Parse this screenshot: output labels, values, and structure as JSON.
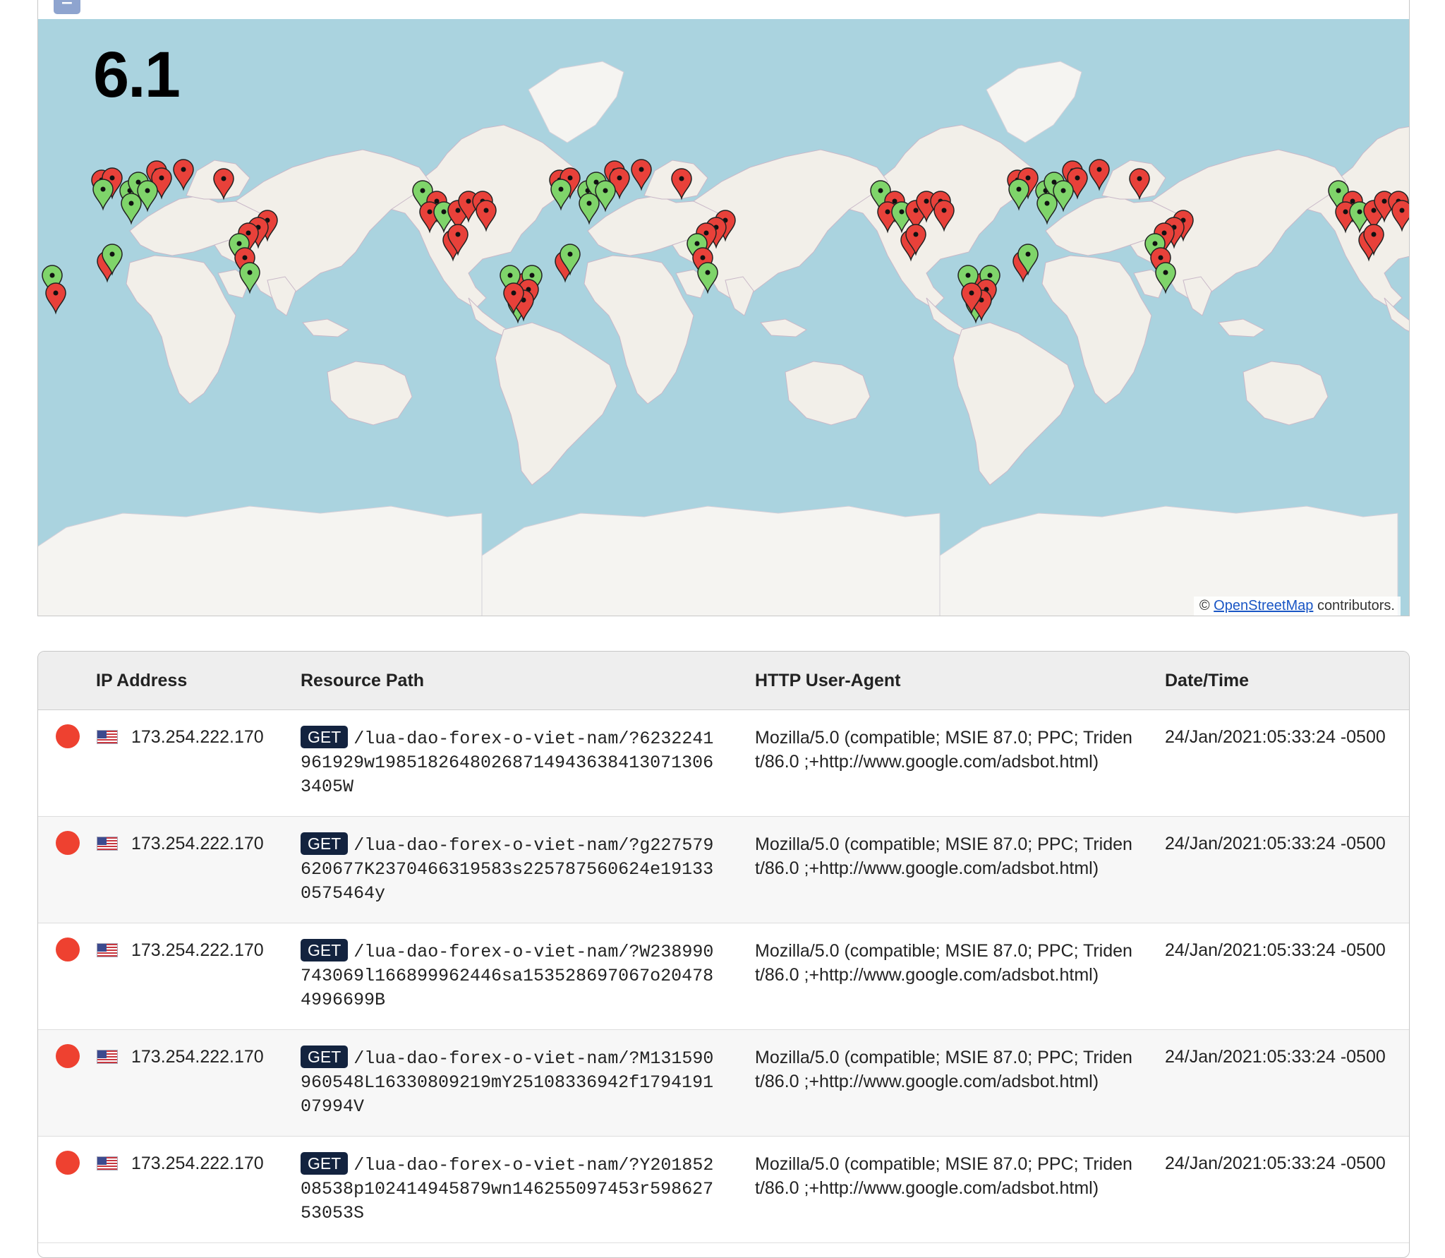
{
  "map": {
    "zoom_out_label": "−",
    "score": "6.1",
    "attribution_prefix": "©",
    "attribution_link": "OpenStreetMap",
    "attribution_suffix": "contributors.",
    "colors": {
      "ocean": "#aad3df",
      "land": "#f2efe9",
      "ice": "#f5f4f1",
      "marker_red": "#e8413a",
      "marker_green": "#7fd46a"
    }
  },
  "table": {
    "headers": {
      "ip": "IP Address",
      "path": "Resource Path",
      "ua": "HTTP User-Agent",
      "date": "Date/Time"
    },
    "rows": [
      {
        "status_color": "#ee4130",
        "ip": "173.254.222.170",
        "method": "GET",
        "path": "/lua-dao-forex-o-viet-nam/?6232241961929w19851826480268714943638413071306340​5W",
        "ua": "Mozilla/5.0 (compatible; MSIE 87.0; PPC; Trident/86.0 ;+http://www.google.com/adsbot.html)",
        "datetime": "24/Jan/2021:05:33:24 -0500"
      },
      {
        "status_color": "#ee4130",
        "ip": "173.254.222.170",
        "method": "GET",
        "path": "/lua-dao-forex-o-viet-nam/?g227579620677K2370466319583s225787560624e191330575464y",
        "ua": "Mozilla/5.0 (compatible; MSIE 87.0; PPC; Trident/86.0 ;+http://www.google.com/adsbot.html)",
        "datetime": "24/Jan/2021:05:33:24 -0500"
      },
      {
        "status_color": "#ee4130",
        "ip": "173.254.222.170",
        "method": "GET",
        "path": "/lua-dao-forex-o-viet-nam/?W238990743069l166899962446sa153528697067o204784996699B",
        "ua": "Mozilla/5.0 (compatible; MSIE 87.0; PPC; Trident/86.0 ;+http://www.google.com/adsbot.html)",
        "datetime": "24/Jan/2021:05:33:24 -0500"
      },
      {
        "status_color": "#ee4130",
        "ip": "173.254.222.170",
        "method": "GET",
        "path": "/lua-dao-forex-o-viet-nam/?M131590960548L16330809219mY25108336942f179419107994V",
        "ua": "Mozilla/5.0 (compatible; MSIE 87.0; PPC; Trident/86.0 ;+http://www.google.com/adsbot.html)",
        "datetime": "24/Jan/2021:05:33:24 -0500"
      },
      {
        "status_color": "#ee4130",
        "ip": "173.254.222.170",
        "method": "GET",
        "path": "/lua-dao-forex-o-viet-nam/?Y20185208538p102414945879wn146255097453r59862753053S",
        "ua": "Mozilla/5.0 (compatible; MSIE 87.0; PPC; Trident/86.0 ;+http://www.google.com/adsbot.html)",
        "datetime": "24/Jan/2021:05:33:24 -0500"
      }
    ]
  }
}
